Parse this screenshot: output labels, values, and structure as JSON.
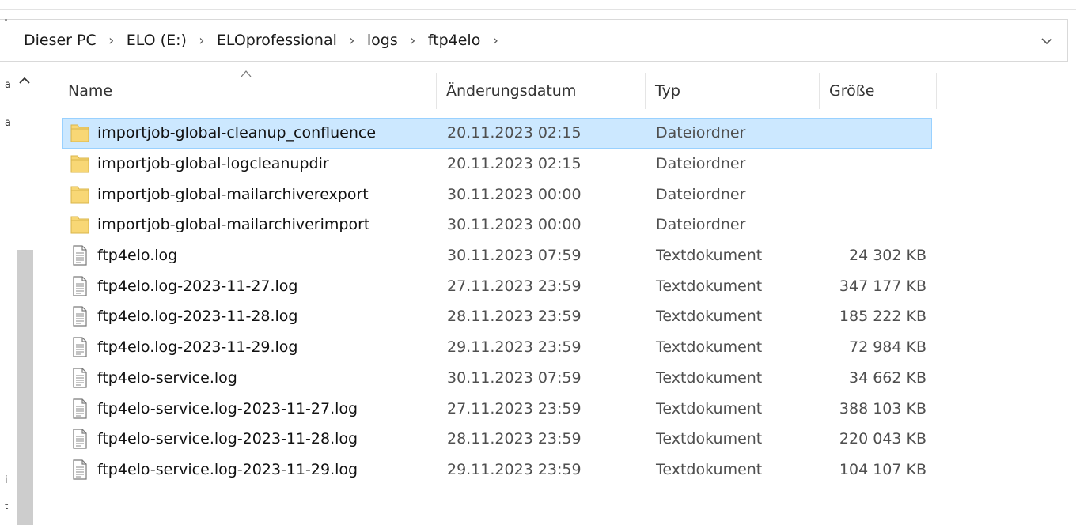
{
  "breadcrumb": [
    "Dieser PC",
    "ELO (E:)",
    "ELOprofessional",
    "logs",
    "ftp4elo"
  ],
  "navigation": {
    "partial_labels": [
      "a",
      "a",
      "i",
      "t"
    ]
  },
  "columns": {
    "name": "Name",
    "date": "Änderungsdatum",
    "type": "Typ",
    "size": "Größe"
  },
  "files": [
    {
      "name": "importjob-global-cleanup_confluence",
      "date": "20.11.2023 02:15",
      "type": "Dateiordner",
      "size": "",
      "icon": "folder-icon",
      "selected": true
    },
    {
      "name": "importjob-global-logcleanupdir",
      "date": "20.11.2023 02:15",
      "type": "Dateiordner",
      "size": "",
      "icon": "folder-icon"
    },
    {
      "name": "importjob-global-mailarchiverexport",
      "date": "30.11.2023 00:00",
      "type": "Dateiordner",
      "size": "",
      "icon": "folder-icon"
    },
    {
      "name": "importjob-global-mailarchiverimport",
      "date": "30.11.2023 00:00",
      "type": "Dateiordner",
      "size": "",
      "icon": "folder-icon"
    },
    {
      "name": "ftp4elo.log",
      "date": "30.11.2023 07:59",
      "type": "Textdokument",
      "size": "24 302 KB",
      "icon": "text-document-icon"
    },
    {
      "name": "ftp4elo.log-2023-11-27.log",
      "date": "27.11.2023 23:59",
      "type": "Textdokument",
      "size": "347 177 KB",
      "icon": "text-document-icon"
    },
    {
      "name": "ftp4elo.log-2023-11-28.log",
      "date": "28.11.2023 23:59",
      "type": "Textdokument",
      "size": "185 222 KB",
      "icon": "text-document-icon"
    },
    {
      "name": "ftp4elo.log-2023-11-29.log",
      "date": "29.11.2023 23:59",
      "type": "Textdokument",
      "size": "72 984 KB",
      "icon": "text-document-icon"
    },
    {
      "name": "ftp4elo-service.log",
      "date": "30.11.2023 07:59",
      "type": "Textdokument",
      "size": "34 662 KB",
      "icon": "text-document-icon"
    },
    {
      "name": "ftp4elo-service.log-2023-11-27.log",
      "date": "27.11.2023 23:59",
      "type": "Textdokument",
      "size": "388 103 KB",
      "icon": "text-document-icon"
    },
    {
      "name": "ftp4elo-service.log-2023-11-28.log",
      "date": "28.11.2023 23:59",
      "type": "Textdokument",
      "size": "220 043 KB",
      "icon": "text-document-icon"
    },
    {
      "name": "ftp4elo-service.log-2023-11-29.log",
      "date": "29.11.2023 23:59",
      "type": "Textdokument",
      "size": "104 107 KB",
      "icon": "text-document-icon"
    }
  ],
  "colors": {
    "selection_background": "#cce8ff",
    "selection_border": "#99d1ff",
    "folder": "#f8d775",
    "scrollbar_thumb": "#cdcdcd"
  }
}
